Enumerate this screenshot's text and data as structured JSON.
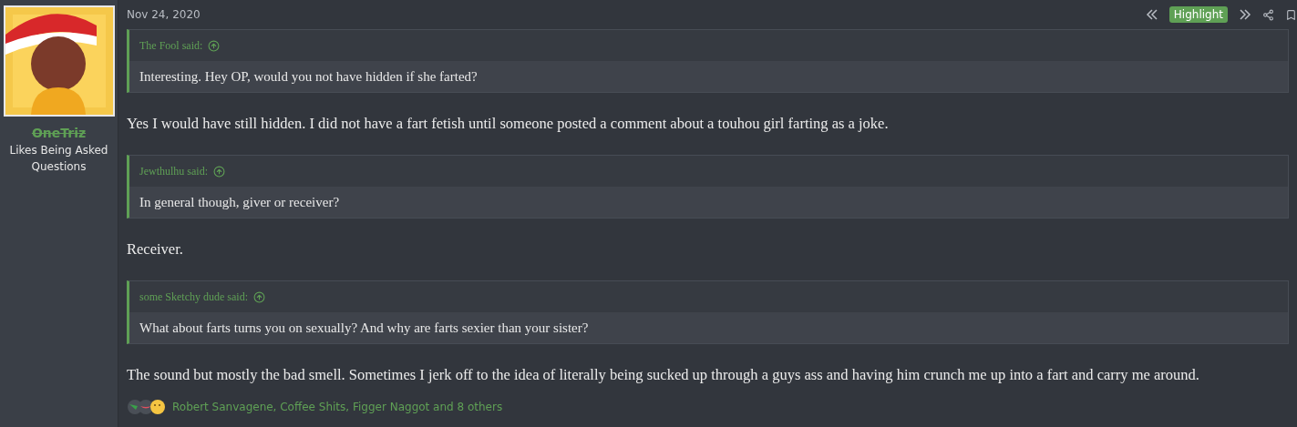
{
  "author": {
    "name": "OneTriz",
    "title": "Likes Being Asked Questions"
  },
  "post": {
    "date": "Nov 24, 2020",
    "highlight": "Highlight",
    "body": [
      {
        "kind": "quote",
        "author": "The Fool said:",
        "text": "Interesting. Hey OP, would you not have hidden if she farted?"
      },
      {
        "kind": "text",
        "text": "Yes I would have still hidden. I did not have a fart fetish until someone posted a comment about a touhou girl farting as a joke."
      },
      {
        "kind": "quote",
        "author": "Jewthulhu said:",
        "text": "In general though, giver or receiver?"
      },
      {
        "kind": "text",
        "text": "Receiver."
      },
      {
        "kind": "quote",
        "author": "some Sketchy dude said:",
        "text": "What about farts turns you on sexually? And why are farts sexier than your sister?"
      },
      {
        "kind": "text",
        "text": "The sound but mostly the bad smell. Sometimes I jerk off to the idea of literally being sucked up through a guys ass and having him crunch me up into a fart and carry me around."
      }
    ],
    "reactions": "Robert Sanvagene, Coffee Shits, Figger Naggot and 8 others"
  }
}
